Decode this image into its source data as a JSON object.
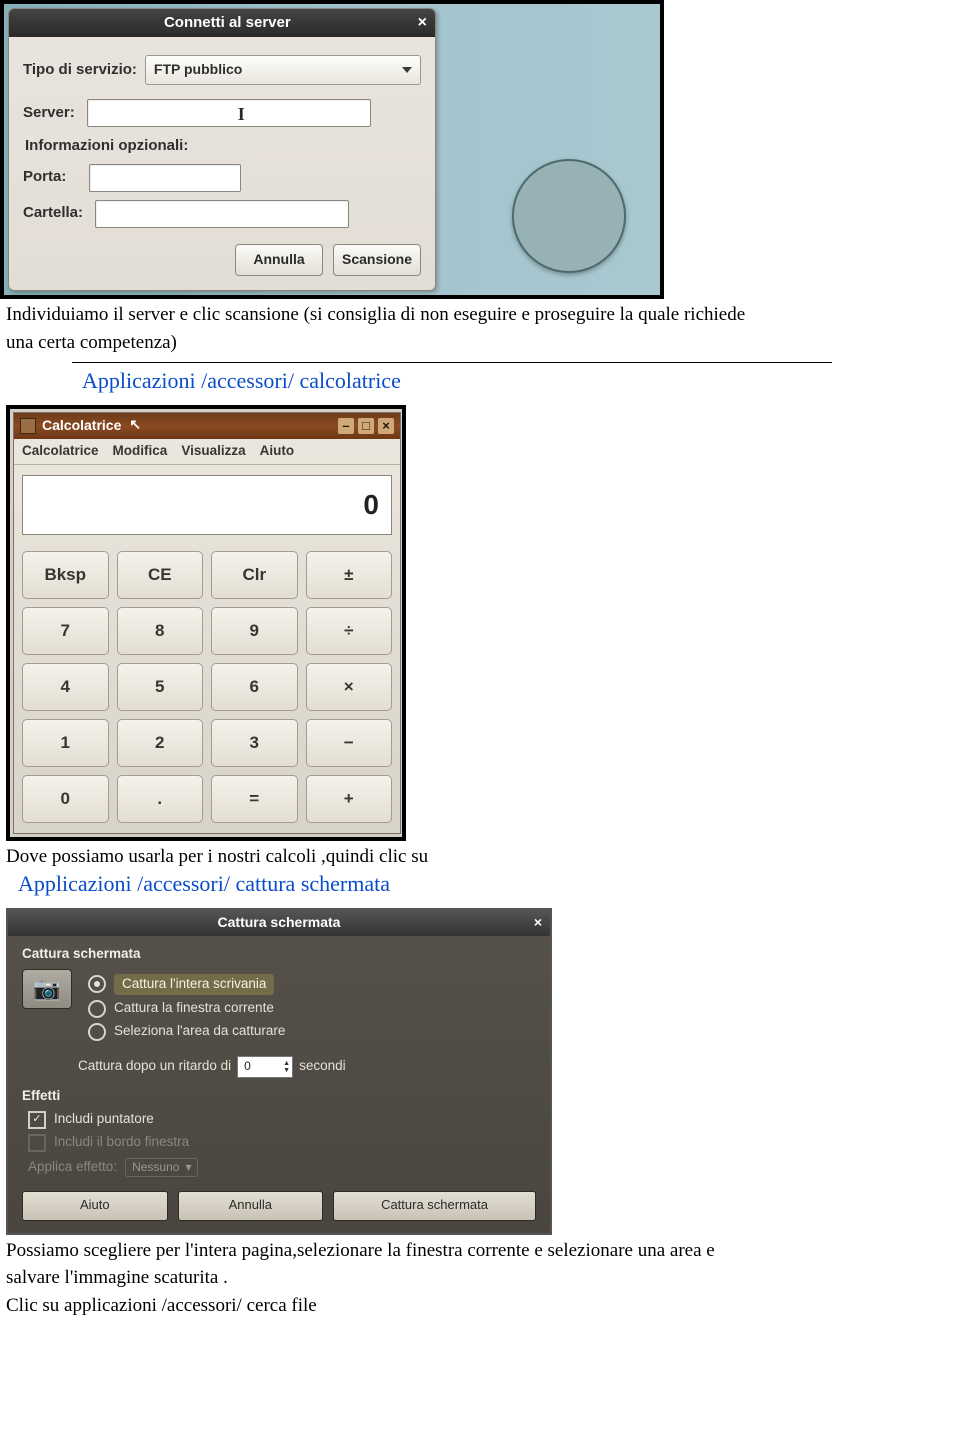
{
  "figure1": {
    "title": "Connetti al server",
    "close_glyph": "×",
    "labels": {
      "service_type": "Tipo di servizio:",
      "server": "Server:",
      "optional_info": "Informazioni opzionali:",
      "port": "Porta:",
      "folder": "Cartella:"
    },
    "service_value": "FTP pubblico",
    "caret_glyph": "I",
    "buttons": {
      "cancel": "Annulla",
      "scan": "Scansione"
    }
  },
  "text": {
    "p1a": "Individuiamo il server  e clic scansione (si consiglia di non eseguire e proseguire la quale richiede",
    "p1b": "una certa competenza)",
    "h1": "Applicazioni /accessori/ calcolatrice",
    "p2a": "Dove possiamo usarla per i nostri calcoli  ,quindi clic su",
    "h2": "Applicazioni /accessori/ cattura schermata",
    "p3a": "Possiamo scegliere per l'intera pagina,selezionare la finestra corrente e selezionare una area e",
    "p3b": "salvare l'immagine scaturita .",
    "p3c": "Clic su applicazioni /accessori/ cerca file"
  },
  "calculator": {
    "title": "Calcolatrice",
    "cursor_glyph": "↖",
    "wincontrols": {
      "min": "–",
      "max": "□",
      "close": "×"
    },
    "menus": [
      "Calcolatrice",
      "Modifica",
      "Visualizza",
      "Aiuto"
    ],
    "display_value": "0",
    "keys": [
      "Bksp",
      "CE",
      "Clr",
      "±",
      "7",
      "8",
      "9",
      "÷",
      "4",
      "5",
      "6",
      "×",
      "1",
      "2",
      "3",
      "−",
      "0",
      ".",
      "=",
      "+"
    ]
  },
  "capture": {
    "title": "Cattura schermata",
    "close_glyph": "×",
    "section1_title": "Cattura schermata",
    "camera_glyph": "📷",
    "opt1": "Cattura l'intera scrivania",
    "opt2": "Cattura la finestra corrente",
    "opt3": "Seleziona l'area da catturare",
    "delay_label": "Cattura dopo un ritardo di",
    "delay_value": "0",
    "delay_unit": "secondi",
    "section2_title": "Effetti",
    "check1": "Includi puntatore",
    "check2": "Includi il bordo finestra",
    "effect_label": "Applica effetto:",
    "effect_value": "Nessuno",
    "buttons": {
      "help": "Aiuto",
      "cancel": "Annulla",
      "shoot": "Cattura schermata"
    }
  }
}
